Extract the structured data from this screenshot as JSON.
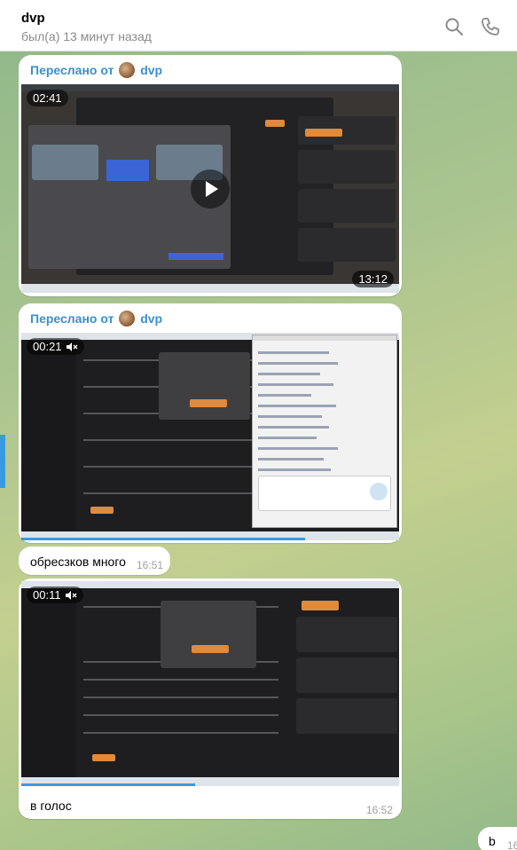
{
  "header": {
    "title": "dvp",
    "status": "был(а) 13 минут назад",
    "search_icon": "search-icon",
    "phone_icon": "phone-icon"
  },
  "messages": [
    {
      "forward_label": "Переслано от",
      "forward_name": "dvp",
      "video_position": "02:41",
      "video_duration": "13:12"
    },
    {
      "forward_label": "Переслано от",
      "forward_name": "dvp",
      "video_position": "00:21",
      "progress": 0.75
    },
    {
      "text": "обресзков много",
      "time": "16:51"
    },
    {
      "video_position": "00:11",
      "progress": 0.46,
      "text": "в голос",
      "time": "16:52"
    },
    {
      "text": "b",
      "time": "16"
    }
  ],
  "colors": {
    "accent": "#3a8fd0",
    "bubble": "#ffffff",
    "wallpaper": "#a9c48f"
  }
}
